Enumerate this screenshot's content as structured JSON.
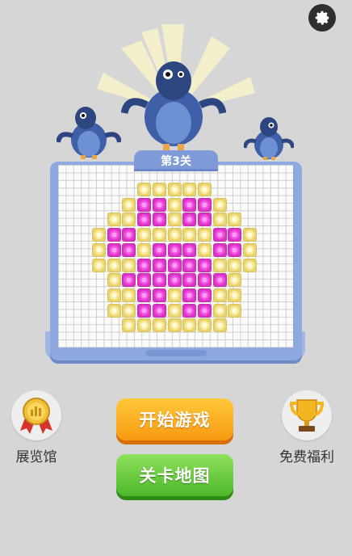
{
  "header": {
    "settings_icon": "gear-icon"
  },
  "level": {
    "label": "第3关"
  },
  "colors": {
    "gem_yellow": "#f6e79a",
    "gem_pink": "#f24fe0",
    "start": "#f79a10",
    "map": "#4cb82a"
  },
  "puzzle": {
    "rows": [
      "...YYYYY...",
      "..YPPYPPY..",
      ".YYPPYPPYY.",
      "YPPYYYYYPPY",
      "YPPYPPPYPPY",
      "YYYPPPPPYYY",
      ".YPPPPPPPY.",
      ".YYPPYPPYY.",
      ".YYPPYPPYY.",
      "..YYYYYYY.."
    ]
  },
  "buttons": {
    "start": "开始游戏",
    "map": "关卡地图",
    "gallery": "展览馆",
    "rewards": "免费福利"
  },
  "icons": {
    "gallery": "medal-icon",
    "rewards": "trophy-icon"
  }
}
